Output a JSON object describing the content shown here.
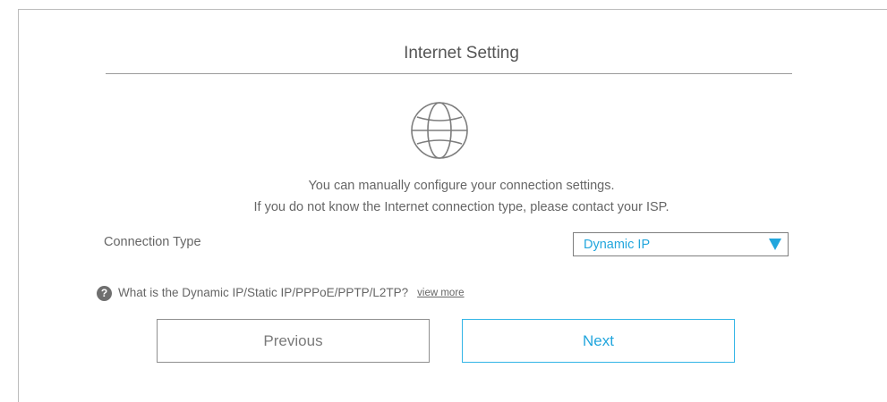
{
  "header": {
    "title": "Internet Setting"
  },
  "icons": {
    "globe": "globe-icon",
    "help": "question-circle-icon",
    "caret": "triangle-down-icon"
  },
  "description": {
    "line1": "You can manually configure your connection settings.",
    "line2": "If you do not know the Internet connection type, please contact your ISP."
  },
  "connection": {
    "label": "Connection Type",
    "selected": "Dynamic IP"
  },
  "help": {
    "question": "What is the Dynamic IP/Static IP/PPPoE/PPTP/L2TP?",
    "link": "view more",
    "icon_glyph": "?"
  },
  "buttons": {
    "previous": "Previous",
    "next": "Next"
  },
  "colors": {
    "accent": "#22a6dd",
    "text": "#666666",
    "border": "#bcbcbc"
  }
}
